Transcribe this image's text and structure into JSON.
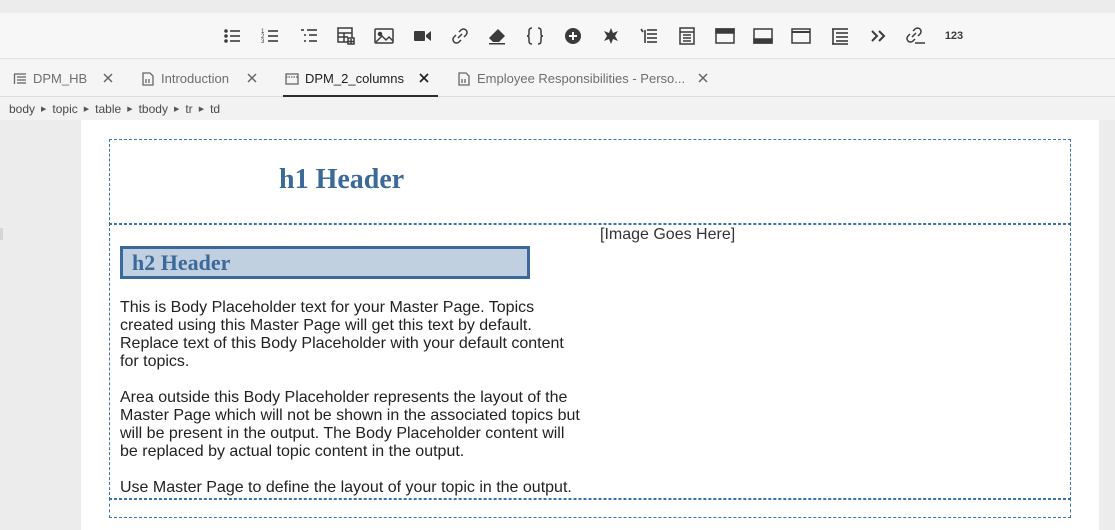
{
  "toolbar": {
    "icons": [
      {
        "name": "bulleted-list-icon"
      },
      {
        "name": "numbered-list-icon"
      },
      {
        "name": "multilevel-list-icon"
      },
      {
        "name": "insert-table-icon"
      },
      {
        "name": "insert-image-icon"
      },
      {
        "name": "insert-video-icon"
      },
      {
        "name": "insert-link-icon"
      },
      {
        "name": "eraser-icon"
      },
      {
        "name": "code-braces-icon"
      },
      {
        "name": "insert-plus-icon"
      },
      {
        "name": "special-character-icon"
      },
      {
        "name": "list-indent-icon"
      },
      {
        "name": "snippet-icon"
      },
      {
        "name": "header-layout-icon"
      },
      {
        "name": "footer-layout-icon"
      },
      {
        "name": "window-layout-icon"
      },
      {
        "name": "table-of-contents-icon"
      },
      {
        "name": "more-chevron-icon"
      },
      {
        "name": "variable-link-icon"
      },
      {
        "name": "numbering-icon",
        "text": "123"
      }
    ]
  },
  "tabs": [
    {
      "label": "DPM_HB",
      "active": false
    },
    {
      "label": "Introduction",
      "active": false
    },
    {
      "label": "DPM_2_columns",
      "active": true
    },
    {
      "label": "Employee Responsibilities - Perso...",
      "active": false
    }
  ],
  "breadcrumb": [
    "body",
    "topic",
    "table",
    "tbody",
    "tr",
    "td"
  ],
  "content": {
    "h1": "h1 Header",
    "h2": "h2 Header",
    "image_placeholder": "[Image Goes Here]",
    "paragraphs": [
      "This is Body Placeholder text for your Master Page. Topics created using this Master Page will get this text by default. Replace text of this Body Placeholder with your default content for topics.",
      "Area outside this Body Placeholder represents the layout of the Master Page which will not be shown in the associated topics but will be present in the output. The Body Placeholder content will be replaced by actual topic content in the output.",
      "Use Master Page to define the layout of your topic in the output."
    ]
  },
  "colors": {
    "heading": "#3b6a9a",
    "h2_background": "#c0d0e0",
    "placeholder_border": "#3a73b0"
  }
}
